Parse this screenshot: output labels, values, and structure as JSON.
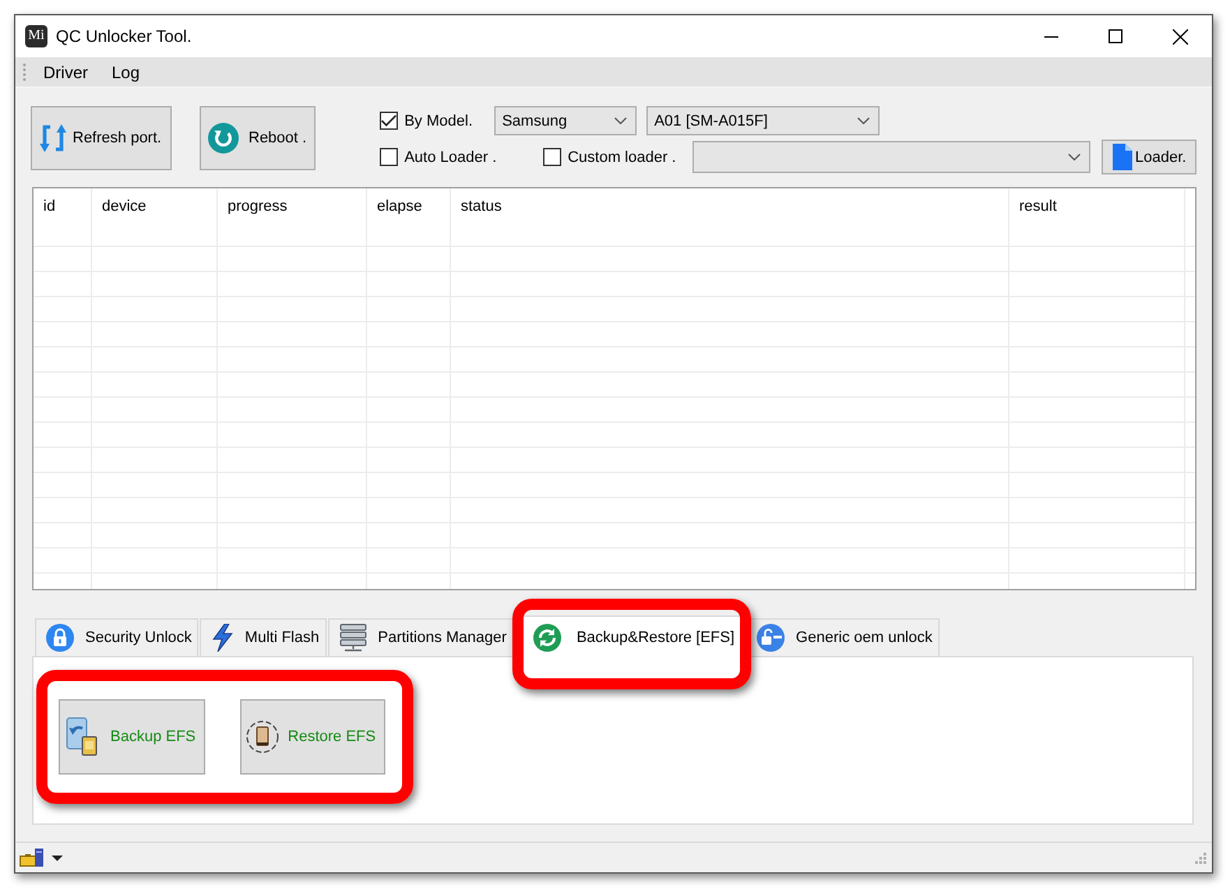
{
  "window": {
    "title": "QC Unlocker Tool.",
    "icon_text": "Mi"
  },
  "menu": [
    {
      "label": "Driver"
    },
    {
      "label": "Log"
    }
  ],
  "toolbar": {
    "buttons": [
      {
        "label": "Refresh port.",
        "kind": "refresh"
      },
      {
        "label": "Reboot .",
        "kind": "reboot"
      }
    ],
    "by_model": {
      "label": "By Model.",
      "checked": true
    },
    "brand": {
      "value": "Samsung"
    },
    "model": {
      "value": "A01 [SM-A015F]"
    },
    "auto_loader": {
      "label": "Auto Loader .",
      "checked": false
    },
    "custom_loader": {
      "label": "Custom loader .",
      "checked": false
    },
    "loader_button": {
      "label": "Loader."
    }
  },
  "table": {
    "columns": [
      "id",
      "device",
      "progress",
      "elapse",
      "status",
      "result"
    ]
  },
  "tabs": [
    {
      "label": "Security Unlock",
      "kind": "lock",
      "selected": false,
      "highlighted": false
    },
    {
      "label": "Multi Flash",
      "kind": "flash",
      "selected": false,
      "highlighted": false
    },
    {
      "label": "Partitions Manager",
      "kind": "partitions",
      "selected": false,
      "highlighted": false
    },
    {
      "label": "Backup&Restore [EFS]",
      "kind": "sync",
      "selected": true,
      "highlighted": true
    },
    {
      "label": "Generic oem unlock",
      "kind": "unlock",
      "selected": false,
      "highlighted": false
    }
  ],
  "efs_panel": {
    "highlighted": true,
    "buttons": [
      {
        "label": "Backup EFS",
        "kind": "backup"
      },
      {
        "label": "Restore EFS",
        "kind": "restore"
      }
    ]
  }
}
